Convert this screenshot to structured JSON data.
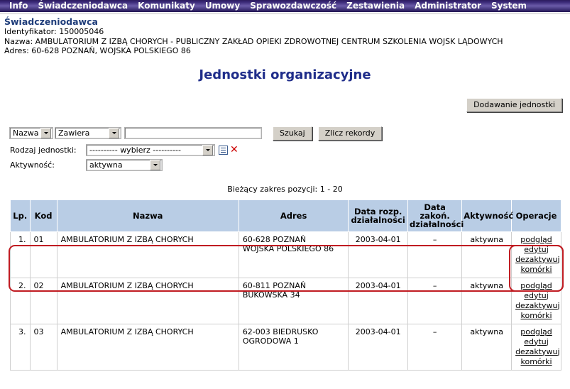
{
  "nav": {
    "items": [
      "Info",
      "Świadczeniodawca",
      "Komunikaty",
      "Umowy",
      "Sprawozdawczość",
      "Zestawienia",
      "Administrator",
      "System"
    ]
  },
  "provider": {
    "title": "Świadczeniodawca",
    "identyfikator": "Identyfikator: 150005046",
    "nazwa": "Nazwa: AMBULATORIUM Z IZBĄ CHORYCH - PUBLICZNY ZAKŁAD OPIEKI ZDROWOTNEJ CENTRUM SZKOLENIA WOJSK LĄDOWYCH",
    "adres": "Adres: 60-628 POZNAŃ, WOJSKA POLSKIEGO 86"
  },
  "page": {
    "title": "Jednostki organizacyjne",
    "add_button": "Dodawanie jednostki",
    "range_label": "Bieżący zakres pozycji: 1 - 20"
  },
  "filters": {
    "field_select": "Nazwa",
    "operator_select": "Zawiera",
    "search_value": "",
    "search_placeholder": "",
    "search_button": "Szukaj",
    "count_button": "Zlicz rekordy",
    "rodzaj_label": "Rodzaj jednostki:",
    "rodzaj_select": "---------- wybierz ----------",
    "aktywnosc_label": "Aktywność:",
    "aktywnosc_select": "aktywna",
    "list_icon": "list-icon",
    "clear_icon": "✕"
  },
  "table": {
    "headers": [
      "Lp.",
      "Kod",
      "Nazwa",
      "Adres",
      "Data rozp. działalności",
      "Data zakoń. działalności",
      "Aktywność",
      "Operacje"
    ],
    "ops_labels": [
      "podgląd",
      "edytuj",
      "dezaktywuj",
      "komórki"
    ],
    "rows": [
      {
        "lp": "1.",
        "kod": "01",
        "nazwa": "AMBULATORIUM Z IZBĄ CHORYCH",
        "adres_line1": "60-628 POZNAŃ",
        "adres_line2": "WOJSKA POLSKIEGO 86",
        "data_rozp": "2003-04-01",
        "data_zakon": "–",
        "aktywnosc": "aktywna"
      },
      {
        "lp": "2.",
        "kod": "02",
        "nazwa": "AMBULATORIUM Z IZBĄ CHORYCH",
        "adres_line1": "60-811 POZNAŃ",
        "adres_line2": "BUKOWSKA 34",
        "data_rozp": "2003-04-01",
        "data_zakon": "–",
        "aktywnosc": "aktywna"
      },
      {
        "lp": "3.",
        "kod": "03",
        "nazwa": "AMBULATORIUM Z IZBĄ CHORYCH",
        "adres_line1": "62-003 BIEDRUSKO",
        "adres_line2": "OGRODOWA 1",
        "data_rozp": "2003-04-01",
        "data_zakon": "–",
        "aktywnosc": "aktywna"
      }
    ]
  },
  "colors": {
    "nav_dark": "#2b1a5e",
    "nav_light": "#6a5aa8",
    "title_blue": "#1f2d8a",
    "header_blue": "#b9cde5",
    "annotation_red": "#c01c22"
  }
}
